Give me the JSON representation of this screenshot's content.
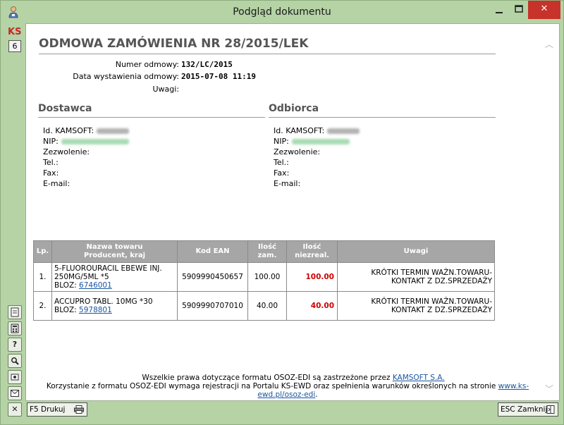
{
  "window": {
    "title": "Podgląd dokumentu"
  },
  "sidebar": {
    "logo": "KS",
    "page_number": "6"
  },
  "document": {
    "title": "ODMOWA ZAMÓWIENIA NR 28/2015/LEK",
    "meta": [
      {
        "label": "Numer odmowy:",
        "value": "132/LC/2015"
      },
      {
        "label": "Data wystawienia odmowy:",
        "value": "2015-07-08 11:19"
      },
      {
        "label": "Uwagi:",
        "value": ""
      }
    ],
    "supplier": {
      "heading": "Dostawca",
      "fields": [
        "Id. KAMSOFT:",
        "NIP:",
        "Zezwolenie:",
        "Tel.:",
        "Fax:",
        "E-mail:"
      ]
    },
    "recipient": {
      "heading": "Odbiorca",
      "fields": [
        "Id. KAMSOFT:",
        "NIP:",
        "Zezwolenie:",
        "Tel.:",
        "Fax:",
        "E-mail:"
      ]
    },
    "table": {
      "headers": [
        "Lp.",
        "Nazwa towaru\nProducent, kraj",
        "Kod EAN",
        "Ilość\nzam.",
        "Ilość\nniezreal.",
        "Uwagi"
      ],
      "rows": [
        {
          "lp": "1.",
          "name_line1": "5-FLUOROURACIL EBEWE INJ.",
          "name_line2": "250MG/5ML *5",
          "bloz_label": "BLOZ:",
          "bloz": "6746001",
          "ean": "5909990450657",
          "qty_ordered": "100.00",
          "qty_unrealized": "100.00",
          "notes_line1": "KRÓTKI TERMIN WAŻN.TOWARU-",
          "notes_line2": "KONTAKT Z DZ.SPRZEDAŻY"
        },
        {
          "lp": "2.",
          "name_line1": "ACCUPRO TABL. 10MG *30",
          "name_line2": "",
          "bloz_label": "BLOZ:",
          "bloz": "5978801",
          "ean": "5909990707010",
          "qty_ordered": "40.00",
          "qty_unrealized": "40.00",
          "notes_line1": "KRÓTKI TERMIN WAŻN.TOWARU-",
          "notes_line2": "KONTAKT Z DZ.SPRZEDAŻY"
        }
      ]
    },
    "footer": {
      "line1_text": "Wszelkie prawa dotyczące formatu OSOZ-EDI są zastrzeżone przez ",
      "line1_link": "KAMSOFT S.A.",
      "line2_text": "Korzystanie z formatu OSOZ-EDI wymaga rejestracji na Portalu KS-EWD oraz spełnienia warunków określonych na stronie ",
      "line2_link": "www.ks-ewd.pl/osoz-edi",
      "line2_end": "."
    }
  },
  "toolbar": {
    "print_label": "F5 Drukuj",
    "close_label": "ESC Zamknij"
  },
  "colors": {
    "frame": "#b5d3a5",
    "close_button": "#c7322a",
    "unrealized_qty": "#d00000",
    "table_header": "#a6a6a6",
    "link": "#1a55a0"
  }
}
